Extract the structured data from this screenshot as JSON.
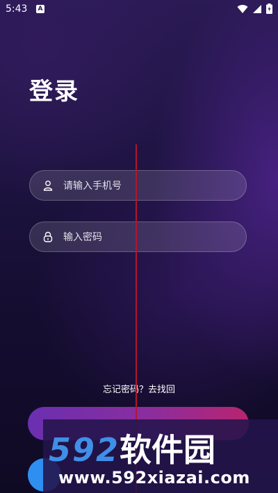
{
  "status_bar": {
    "time": "5:43",
    "notification_badge": "A"
  },
  "page": {
    "title": "登录"
  },
  "form": {
    "phone_placeholder": "请输入手机号",
    "password_placeholder": "输入密码",
    "forgot_text": "忘记密码？去找回"
  },
  "watermark": {
    "brand_number": "592",
    "brand_name": "软件园",
    "url": "www.592xiazai.com"
  },
  "colors": {
    "accent_blue": "#3f8fe8",
    "button_gradient_start": "#6a2fb0",
    "button_gradient_end": "#b8246f",
    "guide_line": "#b3162a"
  },
  "icons": {
    "phone_field": "user-icon",
    "password_field": "lock-icon"
  }
}
